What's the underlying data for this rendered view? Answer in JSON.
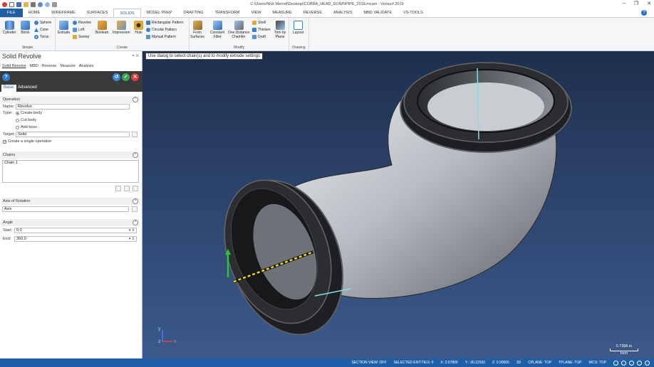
{
  "window": {
    "title": "C:\\Users\\Nick Merrell\\Desktop\\COBRA_HEAD_DOWNPIPE_2018.mcam - Verisurf 2019",
    "controls": [
      "–",
      "❐",
      "✕"
    ]
  },
  "ribbon_tabs": [
    "FILE",
    "HOME",
    "WIREFRAME",
    "SURFACES",
    "SOLIDS",
    "MODEL PREP",
    "DRAFTING",
    "TRANSFORM",
    "VIEW",
    "MEASURE",
    "REVERSE",
    "ANALYSIS",
    "MBD VALIDATE",
    "VS-TOOLS"
  ],
  "active_tab": "SOLIDS",
  "ribbon": {
    "simple": {
      "label": "Simple",
      "cylinder": "Cylinder",
      "block": "Block",
      "sphere": "Sphere",
      "cone": "Cone",
      "torus": "Torus"
    },
    "create": {
      "label": "Create",
      "extrude": "Extrude",
      "revolve": "Revolve",
      "loft": "Loft",
      "sweep": "Sweep",
      "boolean": "Boolean",
      "impression": "Impression",
      "hole": "Hole",
      "rect_pattern": "Rectangular Pattern",
      "circ_pattern": "Circular Pattern",
      "manual_pattern": "Manual Pattern"
    },
    "modify": {
      "label": "Modify",
      "from_surfaces": "From Surfaces",
      "constant_fillet": "Constant Fillet",
      "one_distance_chamfer": "One Distance Chamfer",
      "shell": "Shell",
      "thicken": "Thicken",
      "draft": "Draft",
      "trim_by_plane": "Trim by Plane"
    },
    "drawing": {
      "label": "Drawing",
      "layout": "Layout"
    }
  },
  "panel": {
    "title": "Solid Revolve",
    "subtabs": [
      "Solid Revolve",
      "MBD",
      "Reverse",
      "Measure",
      "Analysis"
    ],
    "mode_tabs": {
      "basic": "Basic",
      "advanced": "Advanced"
    },
    "operation": {
      "header": "Operation",
      "name_label": "Name:",
      "name_value": "Revolve",
      "type_label": "Type:",
      "type_options": [
        "Create body",
        "Cut body",
        "Add boss"
      ],
      "selected_type": "Create body",
      "target_label": "Target:",
      "target_value": "Solid",
      "single_op_label": "Create a single operation",
      "single_op_checked": true
    },
    "chains": {
      "header": "Chains",
      "items": [
        "Chain  1"
      ]
    },
    "axis": {
      "header": "Axis of Rotation",
      "value": "Axis"
    },
    "angle": {
      "header": "Angle",
      "start_label": "Start:",
      "start_value": "0.0",
      "end_label": "End:",
      "end_value": "360.0"
    }
  },
  "viewport": {
    "prompt": "Use dialog to select chain(s) and to modify extrude settings",
    "axis_labels": {
      "y": "y",
      "x": "x",
      "z": "z"
    },
    "scale_value": "0.7396 in",
    "scale_unit": "Inch"
  },
  "status": {
    "section_view": "SECTION VIEW: OFF",
    "selected": "SELECTED ENTITIES: 0",
    "x": "X:  2.07800",
    "y": "Y:  -30.12593",
    "z": "Z:  0.00000",
    "mode": "3D",
    "cplane": "CPLANE: TOP",
    "tplane": "TPLANE: TOP",
    "wcs": "WCS: TOP"
  },
  "colors": {
    "accent": "#1f5fa8",
    "viewport_top": "#1e2f4d",
    "viewport_bottom": "#3b5a8b"
  }
}
